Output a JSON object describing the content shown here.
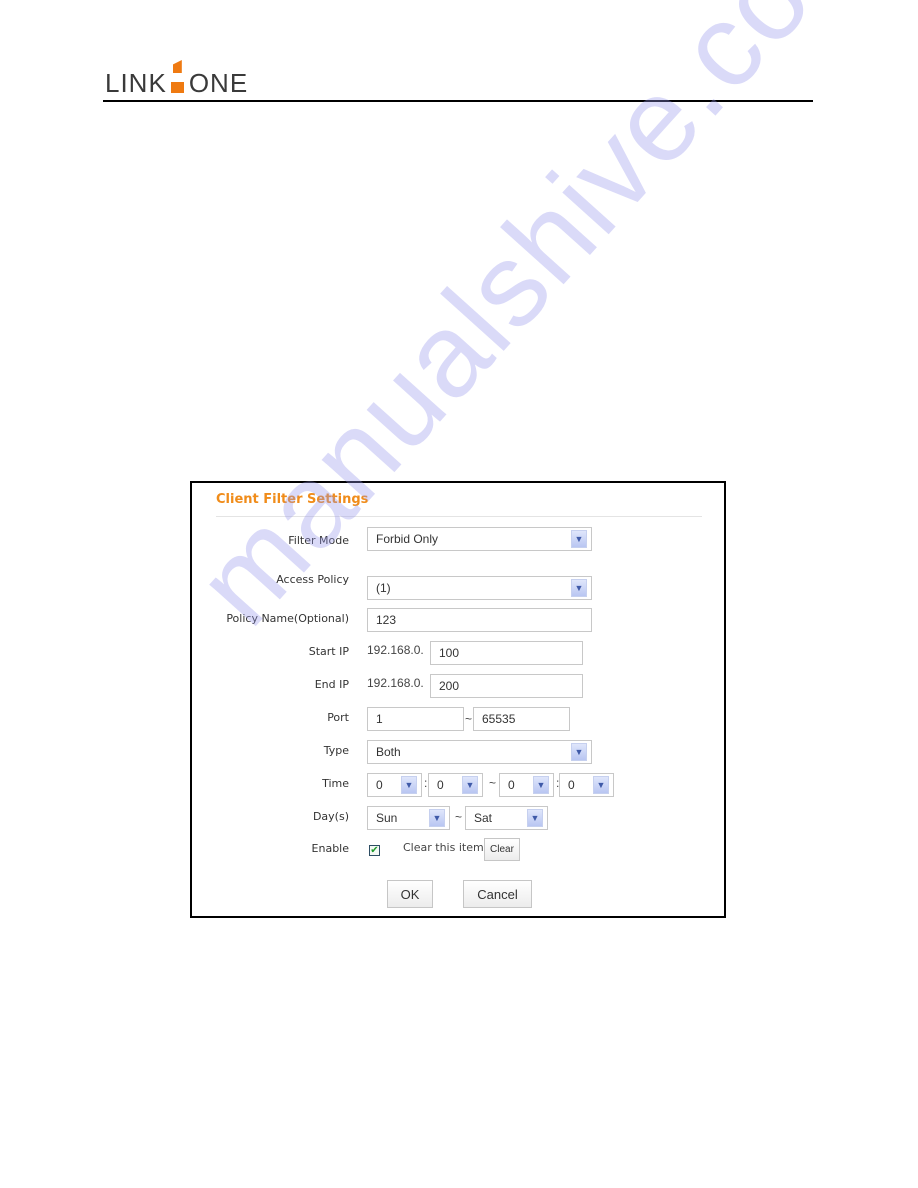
{
  "header": {
    "logo_left": "LINK",
    "logo_right": "ONE",
    "brand_accent": "#ef7a11"
  },
  "panel": {
    "title": "Client Filter Settings",
    "title_color": "#f08c1a",
    "filter_mode": {
      "label": "Filter Mode",
      "value": "Forbid Only"
    },
    "access_policy": {
      "label": "Access Policy",
      "value": "(1)"
    },
    "policy_name": {
      "label": "Policy Name(Optional)",
      "value": "123"
    },
    "start_ip": {
      "label": "Start IP",
      "prefix": "192.168.0.",
      "value": "100"
    },
    "end_ip": {
      "label": "End IP",
      "prefix": "192.168.0.",
      "value": "200"
    },
    "port": {
      "label": "Port",
      "from": "1",
      "separator": "~",
      "to": "65535"
    },
    "type": {
      "label": "Type",
      "value": "Both"
    },
    "time": {
      "label": "Time",
      "start_hour": "0",
      "start_min": "0",
      "separator": "~",
      "colon": ":",
      "end_hour": "0",
      "end_min": "0"
    },
    "days": {
      "label": "Day(s)",
      "from": "Sun",
      "separator": "~",
      "to": "Sat"
    },
    "enable": {
      "label": "Enable",
      "checked": true,
      "check_glyph": "✔"
    },
    "clear_item": {
      "label": "Clear this item:",
      "button": "Clear"
    },
    "ok_button": "OK",
    "cancel_button": "Cancel",
    "caret_glyph": "▼"
  },
  "watermark": "manualshive.com"
}
